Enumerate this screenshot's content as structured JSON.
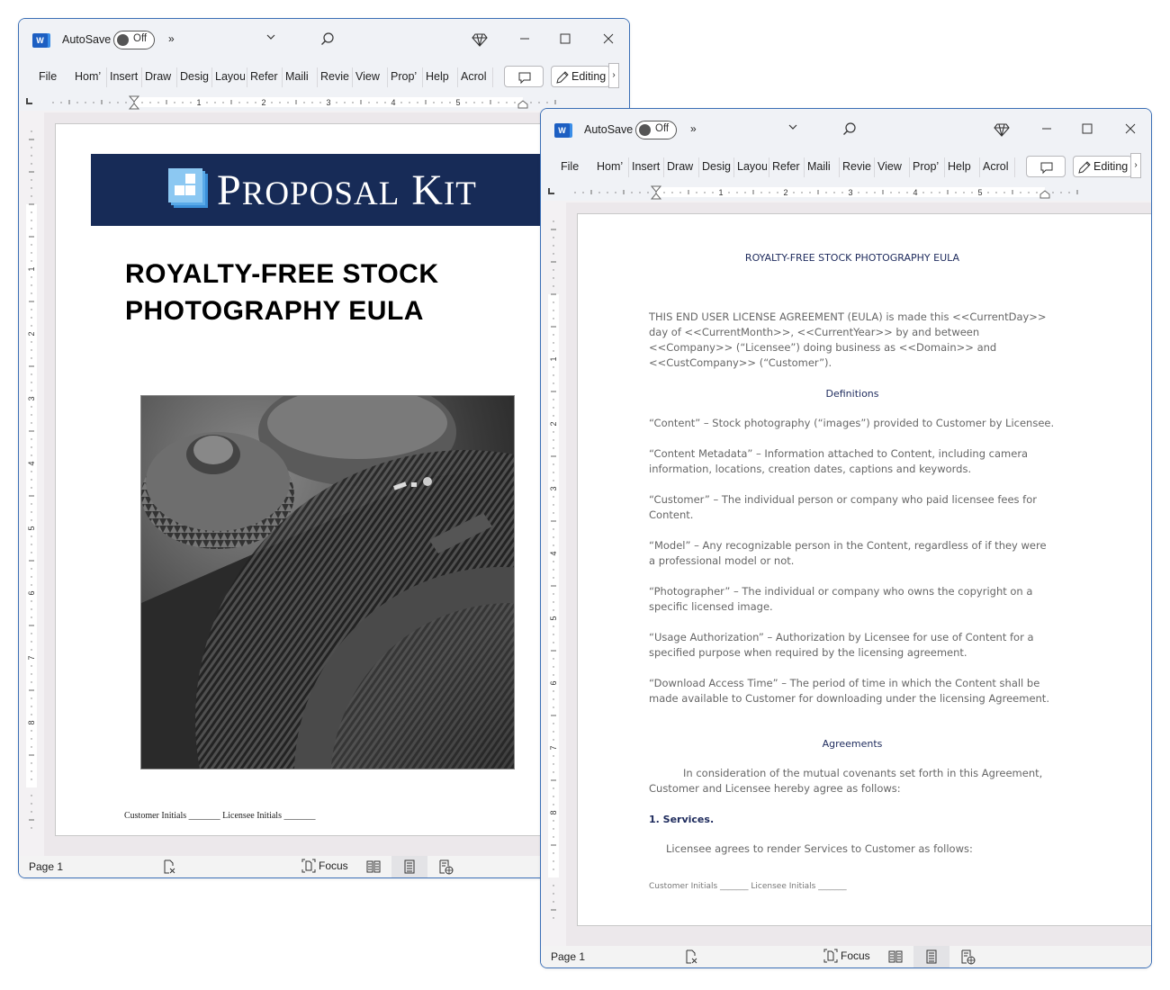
{
  "app": {
    "autosave_label": "AutoSave",
    "autosave_state": "Off",
    "more_commands": "»",
    "ribbon_tabs": [
      "File",
      "Home",
      "Insert",
      "Draw",
      "Design",
      "Layout",
      "References",
      "Mailings",
      "Review",
      "View",
      "Properties",
      "Help",
      "Acrobat"
    ],
    "ribbon_tabs_visible": [
      "File",
      "Hom’",
      "Insert",
      "Draw",
      "Desig",
      "Layou",
      "Refer",
      "Maili",
      "Revie",
      "View",
      "Prop’",
      "Help",
      "Acrol"
    ],
    "editing_label": "Editing",
    "ruler_numbers": [
      "1",
      "2",
      "3",
      "4",
      "5"
    ],
    "vruler_numbers": [
      "1",
      "2",
      "3",
      "4",
      "5",
      "6",
      "7",
      "8"
    ]
  },
  "window1": {
    "status": {
      "page": "Page 1",
      "focus": "Focus"
    },
    "page": {
      "brand": {
        "first": "P",
        "first_rest": "ROPOSAL",
        "second": "K",
        "second_rest": "IT"
      },
      "title_line1": "ROYALTY-FREE STOCK",
      "title_line2": "PHOTOGRAPHY EULA",
      "photo_alt": "Black and white close-up of a camera body and lens",
      "footer": "Customer Initials _______ Licensee Initials _______"
    }
  },
  "window2": {
    "status": {
      "page": "Page 1",
      "focus": "Focus"
    },
    "page": {
      "title": "ROYALTY-FREE STOCK PHOTOGRAPHY EULA",
      "intro": "THIS END USER LICENSE AGREEMENT (EULA) is made this <<CurrentDay>> day of <<CurrentMonth>>, <<CurrentYear>> by and between <<Company>> (“Licensee”) doing business as <<Domain>> and <<CustCompany>> (“Customer”).",
      "definitions_heading": "Definitions",
      "definitions": [
        "“Content” – Stock photography (“images”) provided to Customer by Licensee.",
        "“Content Metadata” – Information attached to Content, including camera information, locations, creation dates, captions and keywords.",
        "“Customer” – The individual person or company who paid licensee fees for Content.",
        "“Model” – Any recognizable person in the Content, regardless of if they were a professional model or not.",
        "“Photographer” – The individual or company who owns the copyright on a specific licensed image.",
        "“Usage Authorization” – Authorization by Licensee for use of Content for a specified purpose when required by the licensing agreement.",
        "“Download Access Time” – The period of time in which the Content shall be made available to Customer for downloading under the licensing Agreement."
      ],
      "agreements_heading": "Agreements",
      "agreements_intro": "In consideration of the mutual covenants set forth in this Agreement, Customer and Licensee hereby agree as follows:",
      "section1_heading": "1. Services.",
      "section1_text": "Licensee agrees to render Services to Customer as follows:",
      "footer": "Customer Initials _______ Licensee Initials _______"
    }
  },
  "colors": {
    "brand_navy": "#172b57",
    "heading_navy": "#1d2a5c",
    "window_border": "#3b6fb6",
    "word_blue": "#1d5fc2"
  }
}
